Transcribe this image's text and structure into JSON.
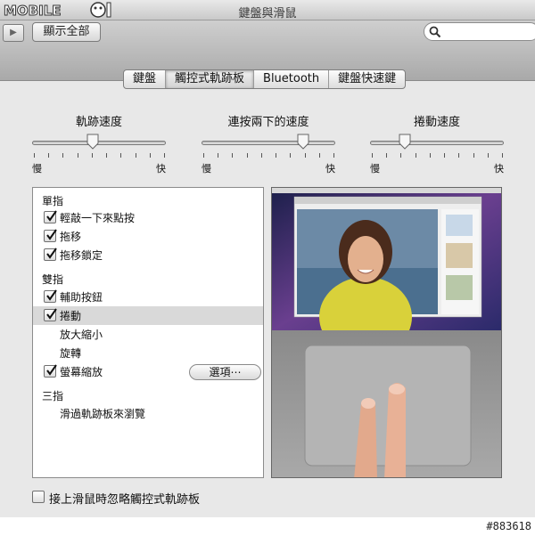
{
  "window": {
    "title": "鍵盤與滑鼠"
  },
  "toolbar": {
    "show_all_label": "顯示全部",
    "search_placeholder": ""
  },
  "tabs": [
    {
      "label": "鍵盤",
      "selected": false
    },
    {
      "label": "觸控式軌跡板",
      "selected": true
    },
    {
      "label": "Bluetooth",
      "selected": false
    },
    {
      "label": "鍵盤快速鍵",
      "selected": false
    }
  ],
  "sliders": [
    {
      "label": "軌跡速度",
      "min_label": "慢",
      "max_label": "快",
      "value": 0.45
    },
    {
      "label": "連按兩下的速度",
      "min_label": "慢",
      "max_label": "快",
      "value": 0.77
    },
    {
      "label": "捲動速度",
      "min_label": "慢",
      "max_label": "快",
      "value": 0.25
    }
  ],
  "options": {
    "one_finger": {
      "heading": "單指",
      "items": [
        {
          "label": "輕敲一下來點按",
          "checked": true
        },
        {
          "label": "拖移",
          "checked": true
        },
        {
          "label": "拖移鎖定",
          "checked": true
        }
      ]
    },
    "two_fingers": {
      "heading": "雙指",
      "items": [
        {
          "label": "輔助按鈕",
          "checked": true
        },
        {
          "label": "捲動",
          "checked": true
        },
        {
          "label": "放大縮小"
        },
        {
          "label": "旋轉"
        },
        {
          "label": "螢幕縮放",
          "checked": true
        }
      ],
      "options_button": "選項⋯"
    },
    "three_fingers": {
      "heading": "三指",
      "items": [
        {
          "label": "滑過軌跡板來瀏覽"
        }
      ]
    }
  },
  "ignore_trackpad": {
    "label": "接上滑鼠時忽略觸控式軌跡板",
    "checked": false
  },
  "watermark": {
    "logo_text": "MOBILE01",
    "post_id": "#883618"
  }
}
